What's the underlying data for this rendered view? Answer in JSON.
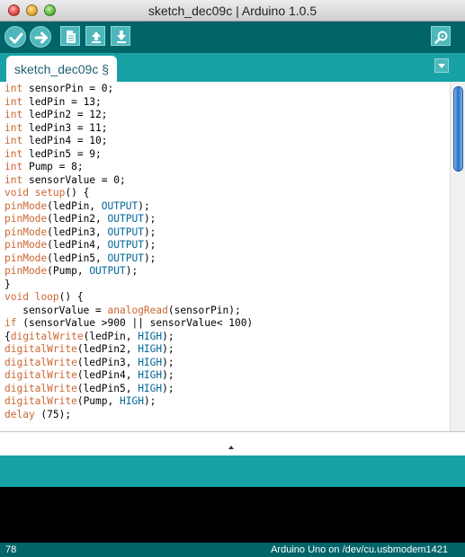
{
  "window": {
    "title": "sketch_dec09c | Arduino 1.0.5"
  },
  "toolbar": {
    "buttons": [
      {
        "name": "verify",
        "icon": "check-icon"
      },
      {
        "name": "upload",
        "icon": "arrow-right-icon"
      },
      {
        "name": "new",
        "icon": "new-file-icon"
      },
      {
        "name": "open",
        "icon": "arrow-up-icon"
      },
      {
        "name": "save",
        "icon": "arrow-down-icon"
      },
      {
        "name": "serial-monitor",
        "icon": "magnifier-icon"
      }
    ]
  },
  "tabs": [
    {
      "label": "sketch_dec09c §"
    }
  ],
  "editor": {
    "lines": [
      [
        {
          "t": "int",
          "c": "kw"
        },
        {
          "t": " sensorPin = 0;"
        }
      ],
      [
        {
          "t": "int",
          "c": "kw"
        },
        {
          "t": " ledPin = 13;"
        }
      ],
      [
        {
          "t": "int",
          "c": "kw"
        },
        {
          "t": " ledPin2 = 12;"
        }
      ],
      [
        {
          "t": "int",
          "c": "kw"
        },
        {
          "t": " ledPin3 = 11;"
        }
      ],
      [
        {
          "t": "int",
          "c": "kw"
        },
        {
          "t": " ledPin4 = 10;"
        }
      ],
      [
        {
          "t": "int",
          "c": "kw"
        },
        {
          "t": " ledPin5 = 9;"
        }
      ],
      [
        {
          "t": "int",
          "c": "kw"
        },
        {
          "t": " Pump = 8;"
        }
      ],
      [
        {
          "t": "int",
          "c": "kw"
        },
        {
          "t": " sensorValue = 0;"
        }
      ],
      [
        {
          "t": "void",
          "c": "kw"
        },
        {
          "t": " "
        },
        {
          "t": "setup",
          "c": "fn"
        },
        {
          "t": "() {"
        }
      ],
      [
        {
          "t": "pinMode",
          "c": "fn"
        },
        {
          "t": "(ledPin, "
        },
        {
          "t": "OUTPUT",
          "c": "cn"
        },
        {
          "t": ");"
        }
      ],
      [
        {
          "t": "pinMode",
          "c": "fn"
        },
        {
          "t": "(ledPin2, "
        },
        {
          "t": "OUTPUT",
          "c": "cn"
        },
        {
          "t": ");"
        }
      ],
      [
        {
          "t": "pinMode",
          "c": "fn"
        },
        {
          "t": "(ledPin3, "
        },
        {
          "t": "OUTPUT",
          "c": "cn"
        },
        {
          "t": ");"
        }
      ],
      [
        {
          "t": "pinMode",
          "c": "fn"
        },
        {
          "t": "(ledPin4, "
        },
        {
          "t": "OUTPUT",
          "c": "cn"
        },
        {
          "t": ");"
        }
      ],
      [
        {
          "t": "pinMode",
          "c": "fn"
        },
        {
          "t": "(ledPin5, "
        },
        {
          "t": "OUTPUT",
          "c": "cn"
        },
        {
          "t": ");"
        }
      ],
      [
        {
          "t": "pinMode",
          "c": "fn"
        },
        {
          "t": "(Pump, "
        },
        {
          "t": "OUTPUT",
          "c": "cn"
        },
        {
          "t": ");"
        }
      ],
      [
        {
          "t": "}"
        }
      ],
      [
        {
          "t": "void",
          "c": "kw"
        },
        {
          "t": " "
        },
        {
          "t": "loop",
          "c": "fn"
        },
        {
          "t": "() {"
        }
      ],
      [
        {
          "t": "   sensorValue = "
        },
        {
          "t": "analogRead",
          "c": "fn"
        },
        {
          "t": "(sensorPin);"
        }
      ],
      [
        {
          "t": "if",
          "c": "kw"
        },
        {
          "t": " (sensorValue >900 || sensorValue< 100)"
        }
      ],
      [
        {
          "t": "{"
        },
        {
          "t": "digitalWrite",
          "c": "fn"
        },
        {
          "t": "(ledPin, "
        },
        {
          "t": "HIGH",
          "c": "cn"
        },
        {
          "t": ");"
        }
      ],
      [
        {
          "t": "digitalWrite",
          "c": "fn"
        },
        {
          "t": "(ledPin2, "
        },
        {
          "t": "HIGH",
          "c": "cn"
        },
        {
          "t": ");"
        }
      ],
      [
        {
          "t": "digitalWrite",
          "c": "fn"
        },
        {
          "t": "(ledPin3, "
        },
        {
          "t": "HIGH",
          "c": "cn"
        },
        {
          "t": ");"
        }
      ],
      [
        {
          "t": "digitalWrite",
          "c": "fn"
        },
        {
          "t": "(ledPin4, "
        },
        {
          "t": "HIGH",
          "c": "cn"
        },
        {
          "t": ");"
        }
      ],
      [
        {
          "t": "digitalWrite",
          "c": "fn"
        },
        {
          "t": "(ledPin5, "
        },
        {
          "t": "HIGH",
          "c": "cn"
        },
        {
          "t": ");"
        }
      ],
      [
        {
          "t": "digitalWrite",
          "c": "fn"
        },
        {
          "t": "(Pump, "
        },
        {
          "t": "HIGH",
          "c": "cn"
        },
        {
          "t": ");"
        }
      ],
      [
        {
          "t": "delay",
          "c": "fn"
        },
        {
          "t": " (75);"
        }
      ]
    ]
  },
  "footer": {
    "line_number": "78",
    "board": "Arduino Uno on /dev/cu.usbmodem1421"
  },
  "colors": {
    "toolbar_bg": "#006468",
    "tabs_bg": "#17a1a5",
    "button_fill": "#4db7bb",
    "keyword": "#cc6633",
    "constant": "#006699",
    "tab_text": "#1f5f70"
  }
}
